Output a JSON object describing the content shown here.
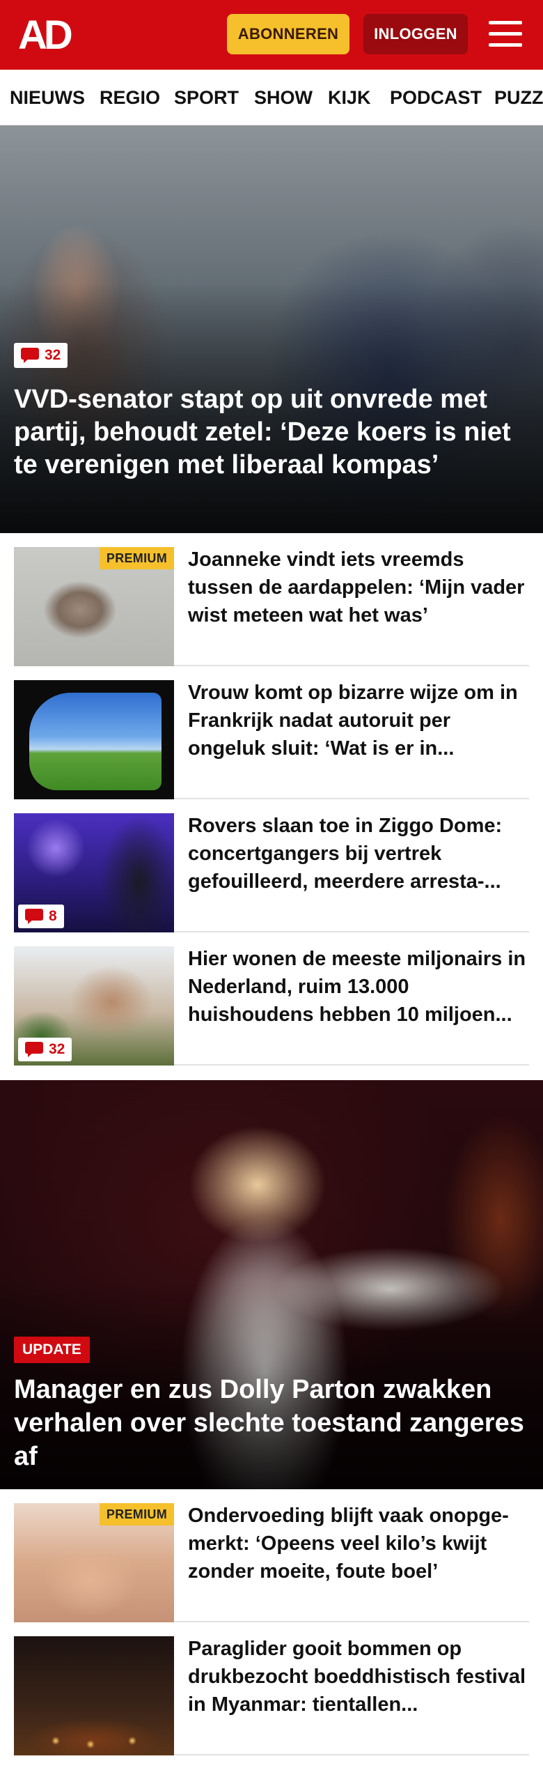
{
  "header": {
    "logo_text": "AD",
    "subscribe_label": "ABONNEREN",
    "login_label": "INLOGGEN",
    "menu_icon": "hamburger-menu-icon",
    "bg_color": "#d10a11",
    "subscribe_color": "#f5c02c"
  },
  "nav": {
    "items": [
      "NIEUWS",
      "REGIO",
      "SPORT",
      "SHOW",
      "KIJK",
      "PODCAST",
      "PUZZ"
    ]
  },
  "hero": {
    "comment_count": "32",
    "title": "VVD-senator stapt op uit onvrede met partij, behoudt zetel: ‘Deze koers is niet te verenigen met liberaal kompas’"
  },
  "articles": [
    {
      "title": "Joanneke vindt iets vreemds tussen de aardappelen: ‘Mijn vader wist meteen wat het was’",
      "badge": "PREMIUM"
    },
    {
      "title": "Vrouw komt op bizarre wijze om in Frankrijk nadat autoruit per ongeluk sluit: ‘Wat is er in..."
    },
    {
      "title": "Rovers slaan toe in Ziggo Dome: concertgangers bij vertrek gefouilleerd, meerdere arresta-...",
      "comment_count": "8"
    },
    {
      "title": "Hier wonen de meeste miljonairs in Nederland, ruim 13.000 huishoudens hebben 10 miljoen...",
      "comment_count": "32"
    }
  ],
  "feature": {
    "badge": "UPDATE",
    "title": "Manager en zus Dolly Parton zwakken verhalen over slechte toestand zangeres af"
  },
  "articles2": [
    {
      "title": "Ondervoeding blijft vaak onopge-merkt: ‘Opeens veel kilo’s kwijt zonder moeite, foute boel’",
      "badge": "PREMIUM"
    },
    {
      "title": "Paraglider gooit bommen op drukbezocht boeddhistisch festival in Myanmar: tientallen..."
    }
  ]
}
